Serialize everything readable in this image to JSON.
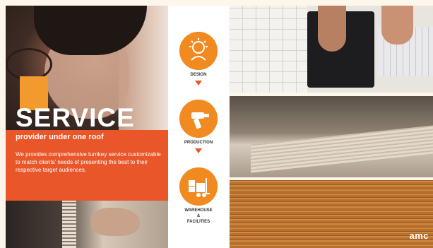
{
  "hero": {
    "title": "SERVICE",
    "subtitle": "provider under one roof",
    "description": "We provides comprehensive turnkey service customizable to match clients' needs of presenting the best to their respective target audiences."
  },
  "process": {
    "steps": [
      {
        "label": "DESIGN",
        "icon": "lightbulb-head-icon"
      },
      {
        "label": "PRODUCTION",
        "icon": "drill-icon"
      },
      {
        "label": "WAREHOUSE\n&\nFACILITIES",
        "icon": "forklift-icon"
      }
    ]
  },
  "brand": {
    "logo_text": "amc"
  },
  "colors": {
    "accent_orange": "#f18a21",
    "accent_red": "#e9562a",
    "square_orange": "#f29a2e"
  }
}
